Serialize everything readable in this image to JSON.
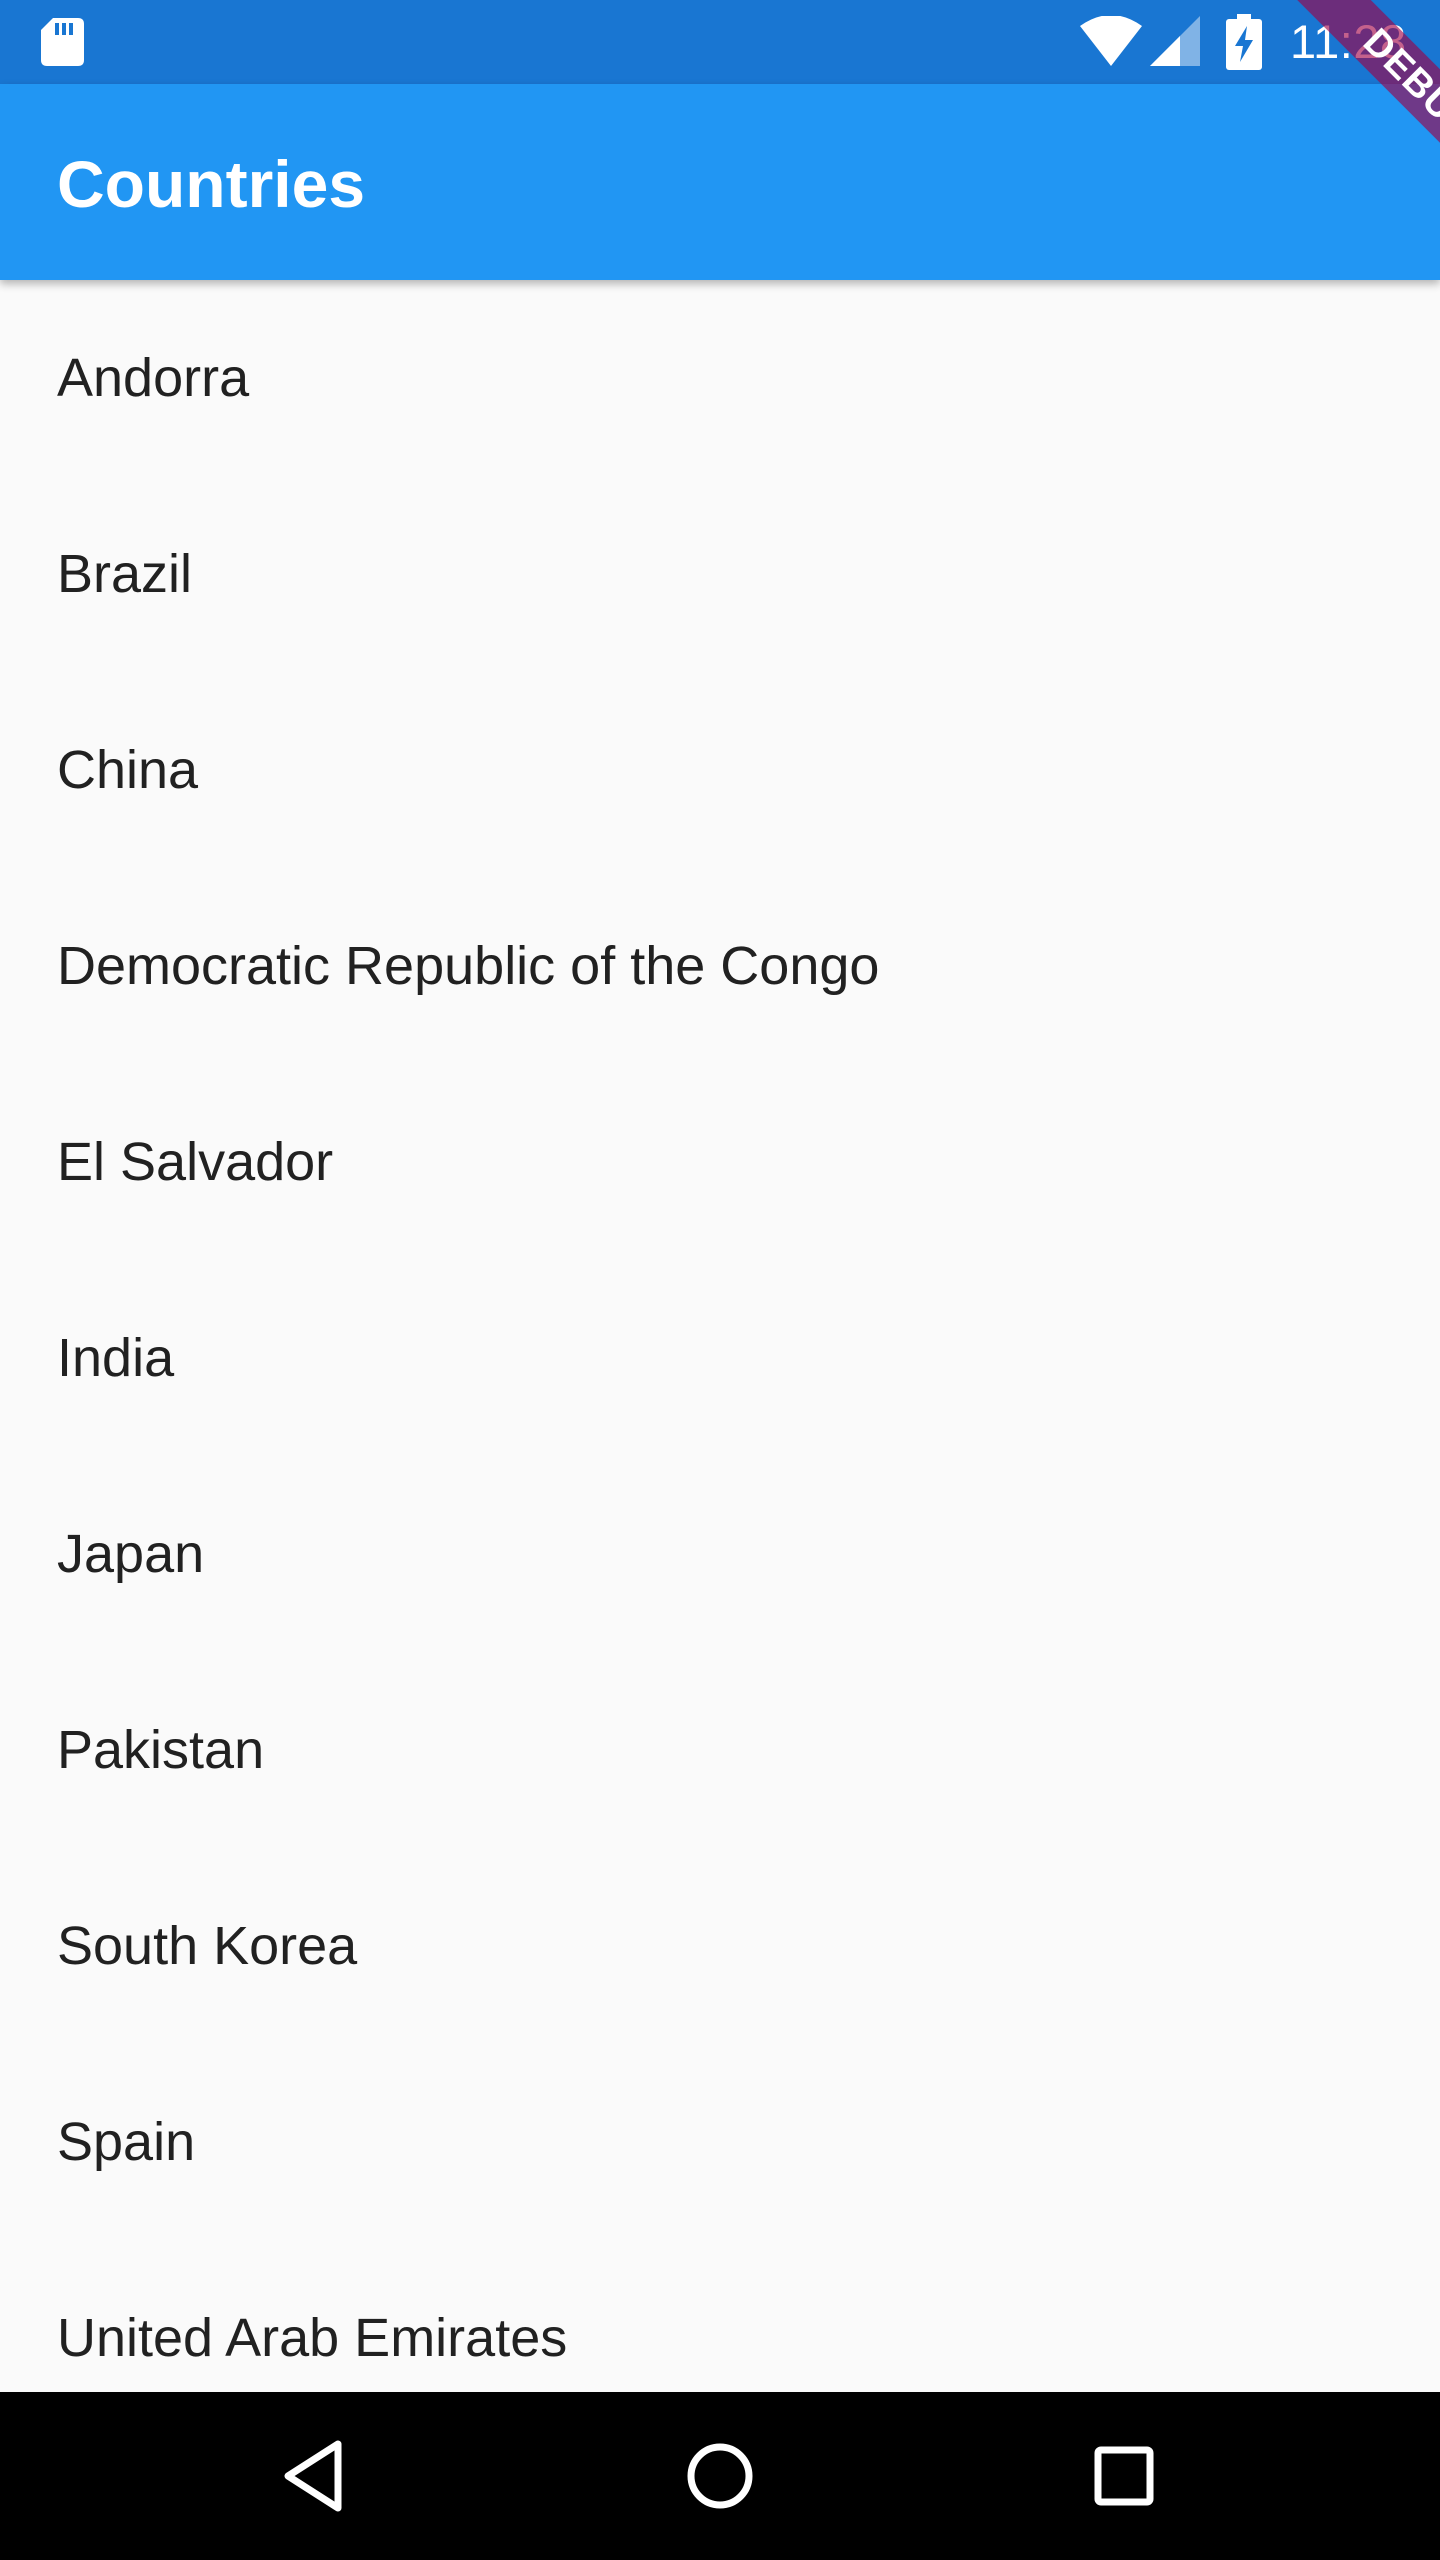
{
  "status_bar": {
    "time": "11:28",
    "icons": [
      "sd-card-icon",
      "wifi-icon",
      "signal-icon",
      "battery-charging-icon"
    ],
    "background_color": "#1976d2"
  },
  "app_bar": {
    "title": "Countries",
    "background_color": "#2196f3"
  },
  "debug_banner": {
    "label": "DEBUG",
    "color": "#a00046"
  },
  "countries": [
    "Andorra",
    "Brazil",
    "China",
    "Democratic Republic of the Congo",
    "El Salvador",
    "India",
    "Japan",
    "Pakistan",
    "South Korea",
    "Spain",
    "United Arab Emirates"
  ],
  "nav_bar": {
    "buttons": [
      "back-icon",
      "home-icon",
      "recents-icon"
    ]
  }
}
